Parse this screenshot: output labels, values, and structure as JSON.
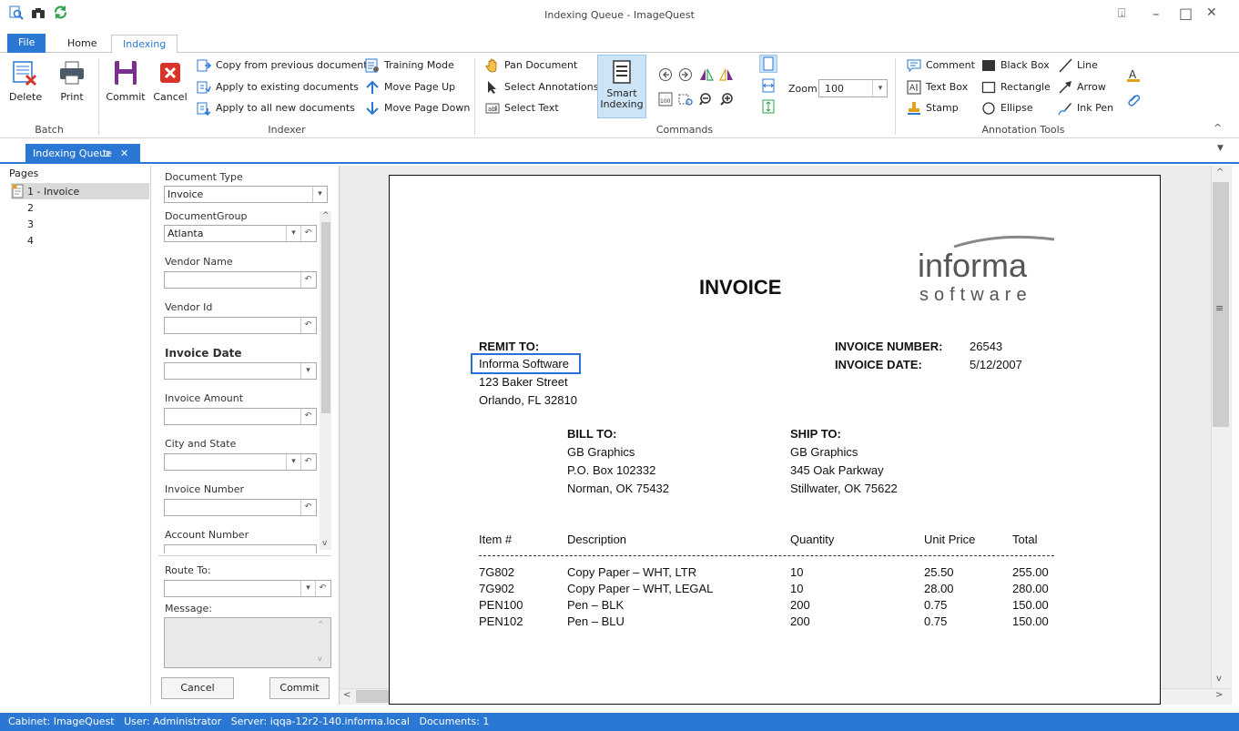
{
  "window": {
    "title": "Indexing Queue - ImageQuest",
    "controls": [
      "⍗",
      "–",
      "□",
      "✕"
    ]
  },
  "ribbon_tabs": [
    "File",
    "Home",
    "Indexing"
  ],
  "ribbon": {
    "batch": {
      "label": "Batch",
      "delete": "Delete",
      "print": "Print"
    },
    "indexer": {
      "label": "Indexer",
      "commit": "Commit",
      "cancel": "Cancel",
      "copy_prev": "Copy from previous document",
      "apply_existing": "Apply to existing documents",
      "apply_new": "Apply to all new documents",
      "training_mode": "Training Mode",
      "move_up": "Move Page Up",
      "move_down": "Move Page Down"
    },
    "commands": {
      "label": "Commands",
      "pan": "Pan Document",
      "select_annotations": "Select Annotations",
      "select_text": "Select Text",
      "smart_indexing_1": "Smart",
      "smart_indexing_2": "Indexing",
      "zoom_label": "Zoom:",
      "zoom_value": "100"
    },
    "annotation_tools": {
      "label": "Annotation Tools",
      "comment": "Comment",
      "text_box": "Text Box",
      "stamp": "Stamp",
      "black_box": "Black Box",
      "rectangle": "Rectangle",
      "ellipse": "Ellipse",
      "line": "Line",
      "arrow": "Arrow",
      "ink_pen": "Ink Pen"
    }
  },
  "doc_tab": {
    "label": "Indexing Queue",
    "pin": "⮌",
    "close": "✕"
  },
  "pages": {
    "header": "Pages",
    "items": [
      "1 - Invoice",
      "2",
      "3",
      "4"
    ]
  },
  "fields": {
    "document_type": {
      "label": "Document Type",
      "value": "Invoice"
    },
    "document_group": {
      "label": "DocumentGroup",
      "value": "Atlanta"
    },
    "vendor_name": {
      "label": "Vendor Name",
      "value": ""
    },
    "vendor_id": {
      "label": "Vendor Id",
      "value": ""
    },
    "invoice_date": {
      "label": "Invoice Date",
      "value": ""
    },
    "invoice_amount": {
      "label": "Invoice Amount",
      "value": ""
    },
    "city_state": {
      "label": "City and State",
      "value": ""
    },
    "invoice_number": {
      "label": "Invoice Number",
      "value": ""
    },
    "account_number": {
      "label": "Account Number",
      "value": ""
    },
    "route_to": {
      "label": "Route To:",
      "value": ""
    },
    "message": {
      "label": "Message:",
      "value": ""
    },
    "cancel_button": "Cancel",
    "commit_button": "Commit"
  },
  "invoice": {
    "title": "INVOICE",
    "logo_top": "informa",
    "logo_bottom": "software",
    "remit_to_label": "REMIT TO:",
    "remit_name": "Informa Software",
    "remit_street": "123 Baker Street",
    "remit_city": "Orlando, FL  32810",
    "invoice_number_label": "INVOICE NUMBER:",
    "invoice_number": "26543",
    "invoice_date_label": "INVOICE DATE:",
    "invoice_date": "5/12/2007",
    "bill_to_label": "BILL TO:",
    "bill_to": [
      "GB Graphics",
      "P.O. Box 102332",
      "Norman, OK  75432"
    ],
    "ship_to_label": "SHIP TO:",
    "ship_to": [
      "GB Graphics",
      "345 Oak Parkway",
      "Stillwater, OK  75622"
    ],
    "columns": [
      "Item #",
      "Description",
      "Quantity",
      "Unit Price",
      "Total"
    ],
    "rows": [
      [
        "7G802",
        "Copy Paper – WHT, LTR",
        "10",
        "25.50",
        "255.00"
      ],
      [
        "7G902",
        "Copy Paper – WHT, LEGAL",
        "10",
        "28.00",
        "280.00"
      ],
      [
        "PEN100",
        "Pen – BLK",
        "200",
        "0.75",
        "150.00"
      ],
      [
        "PEN102",
        "Pen – BLU",
        "200",
        "0.75",
        "150.00"
      ]
    ]
  },
  "status_bar": "Cabinet: ImageQuest   User: Administrator   Server: iqqa-12r2-140.informa.local   Documents: 1",
  "colors": {
    "accent": "#2a78d4",
    "delete_red": "#d9342b",
    "commit_purple": "#7a2f8e"
  }
}
